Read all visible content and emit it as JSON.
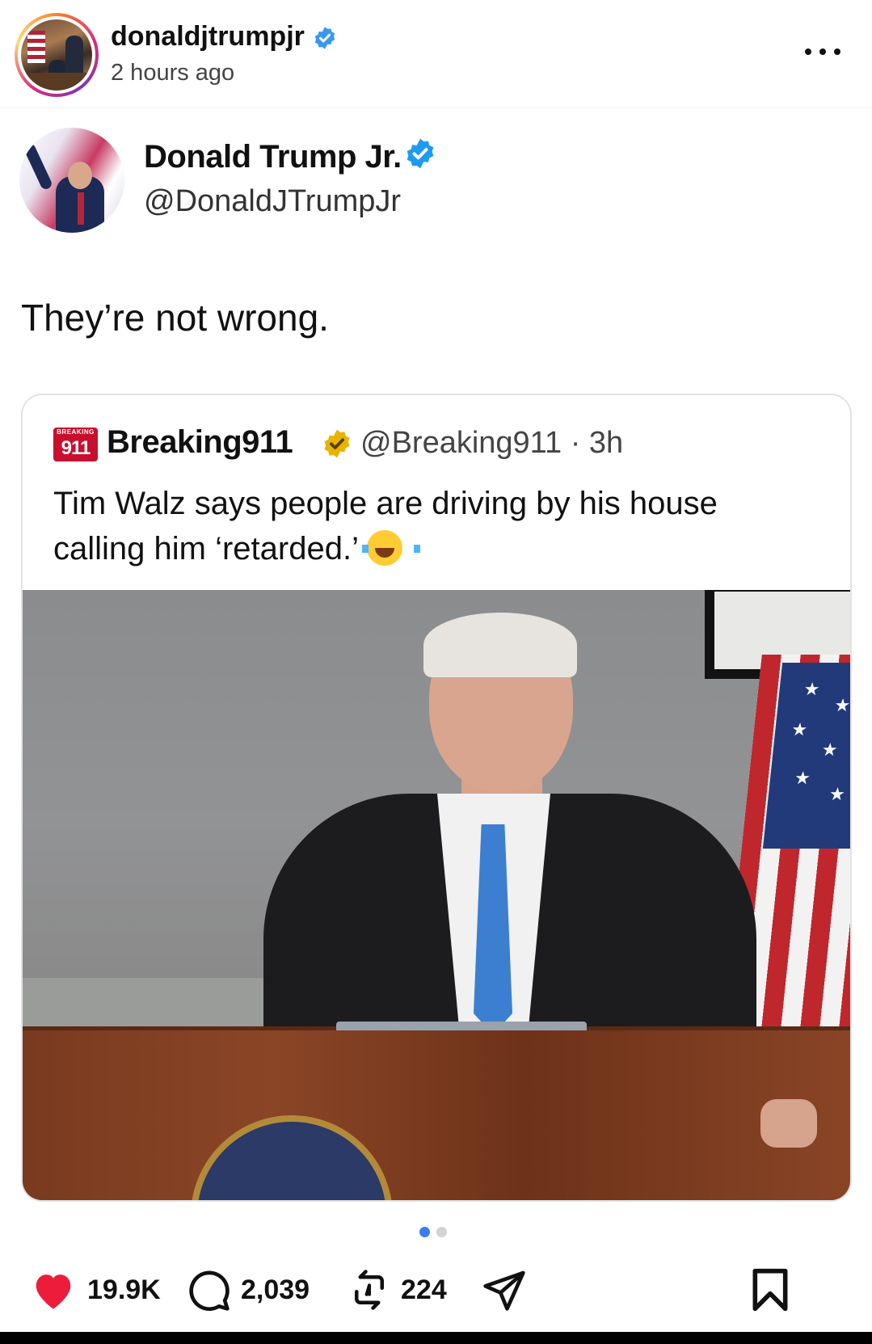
{
  "header": {
    "username": "donaldjtrumpjr",
    "time_ago": "2 hours ago",
    "verified_color": "#3897f0"
  },
  "tweet": {
    "display_name": "Donald Trump Jr.",
    "handle": "@DonaldJTrumpJr",
    "text": "They’re not wrong."
  },
  "quote": {
    "logo_small": "BREAKING",
    "logo_num": "911",
    "name": "Breaking911",
    "meta": "@Breaking911 · 3h",
    "text_line1": "Tim Walz says people are driving by his house",
    "text_line2": "calling him ‘retarded.’",
    "emoji": "face-with-tears-of-joy",
    "badge_color": "#e8b400"
  },
  "carousel": {
    "count": 2,
    "active_index": 0
  },
  "actions": {
    "likes": "19.9K",
    "comments": "2,039",
    "reposts": "224",
    "like_color": "#ed1c3b"
  }
}
